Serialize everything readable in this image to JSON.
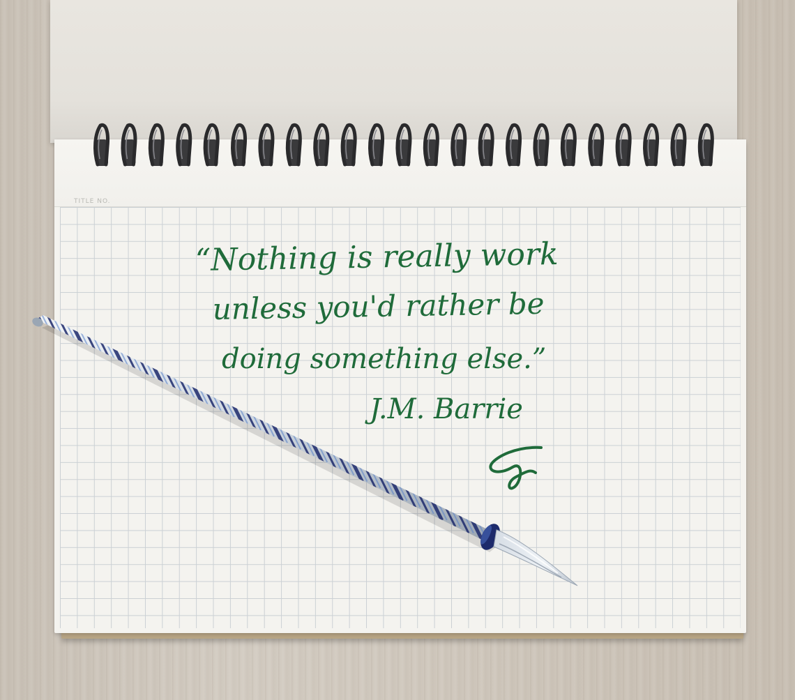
{
  "notebook": {
    "title_label": "TITLE NO.",
    "colors": {
      "paper": "#f4f3ef",
      "grid_line": "#c9cfd3",
      "cardboard": "#b9a685",
      "spiral": "#2a2a2c",
      "desk": "#cfc7bc"
    }
  },
  "quote": {
    "line1": "“Nothing is really work",
    "line2": "unless you'd rather be",
    "line3": "doing something else.”",
    "author": "J.M. Barrie",
    "ink_color": "#1f6b3a"
  },
  "pen": {
    "kind": "glass dip pen",
    "colors": {
      "stripe": "#1d2a6b",
      "glass": "#dfe4ea"
    }
  }
}
